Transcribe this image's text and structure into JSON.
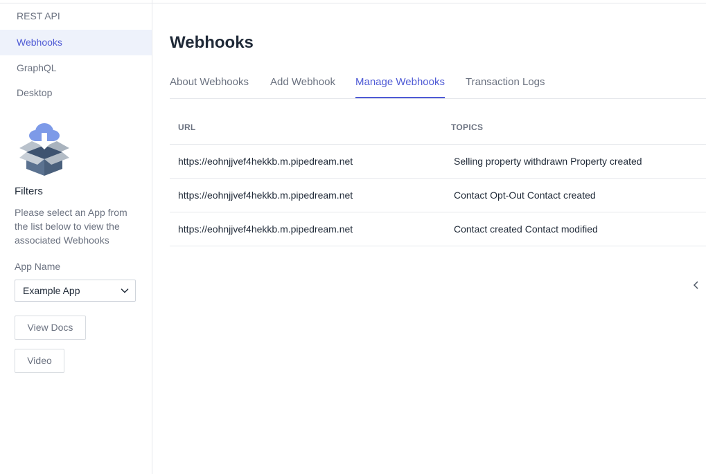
{
  "sidebar": {
    "nav": [
      {
        "label": "REST API",
        "active": false
      },
      {
        "label": "Webhooks",
        "active": true
      },
      {
        "label": "GraphQL",
        "active": false
      },
      {
        "label": "Desktop",
        "active": false
      }
    ],
    "icon": "cloud-download-box-icon",
    "filters_title": "Filters",
    "filters_desc": "Please select an App from the list below to view the associated Webhooks",
    "app_name_label": "App Name",
    "app_selected": "Example App",
    "view_docs_label": "View Docs",
    "video_label": "Video"
  },
  "main": {
    "title": "Webhooks",
    "tabs": [
      {
        "label": "About Webhooks",
        "active": false
      },
      {
        "label": "Add Webhook",
        "active": false
      },
      {
        "label": "Manage Webhooks",
        "active": true
      },
      {
        "label": "Transaction Logs",
        "active": false
      }
    ],
    "table": {
      "headers": {
        "url": "URL",
        "topics": "TOPICS"
      },
      "rows": [
        {
          "url": "https://eohnjjvef4hekkb.m.pipedream.net",
          "topics": "Selling property withdrawn Property created"
        },
        {
          "url": "https://eohnjjvef4hekkb.m.pipedream.net",
          "topics": "Contact Opt-Out Contact created"
        },
        {
          "url": "https://eohnjjvef4hekkb.m.pipedream.net",
          "topics": "Contact created Contact modified"
        }
      ]
    }
  },
  "colors": {
    "accent": "#4f5bd5",
    "active_bg": "#eef2fb",
    "muted_text": "#6b7280",
    "border": "#e5e7eb"
  }
}
